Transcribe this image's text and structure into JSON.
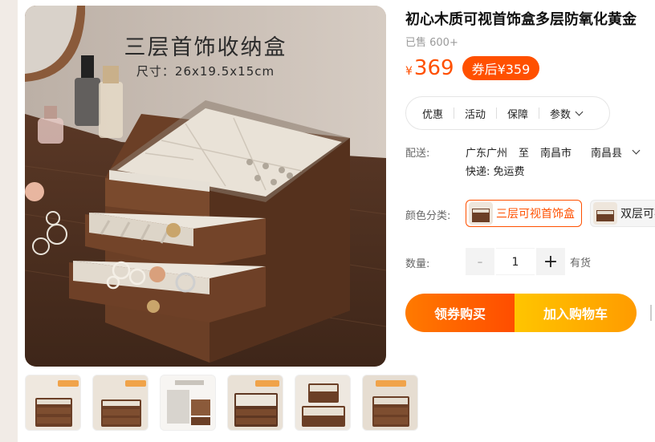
{
  "image": {
    "title": "三层首饰收纳盒",
    "subtitle": "尺寸：26x19.5x15cm"
  },
  "thumbnails": [
    {
      "name": "thumb-1"
    },
    {
      "name": "thumb-2"
    },
    {
      "name": "thumb-3"
    },
    {
      "name": "thumb-4"
    },
    {
      "name": "thumb-5"
    },
    {
      "name": "thumb-6"
    }
  ],
  "product": {
    "title": "初心木质可视首饰盒多层防氧化黄金",
    "sold": "已售 600+",
    "price_symbol": "¥",
    "price": "369",
    "coupon_price": "券后¥359"
  },
  "tabs": [
    "优惠",
    "活动",
    "保障",
    "参数"
  ],
  "shipping": {
    "label": "配送:",
    "from": "广东广州",
    "to_word": "至",
    "city": "南昌市",
    "county": "南昌县",
    "fee": "快递: 免运费"
  },
  "sku": {
    "label": "颜色分类:",
    "options": [
      "三层可视首饰盒",
      "双层可视"
    ]
  },
  "quantity": {
    "label": "数量:",
    "minus": "-",
    "value": "1",
    "plus": "+",
    "stock": "有货"
  },
  "buttons": {
    "coupon_buy": "领券购买",
    "add_cart": "加入购物车"
  },
  "colors": {
    "accent": "#ff5000",
    "wood": "#6b3f26"
  }
}
